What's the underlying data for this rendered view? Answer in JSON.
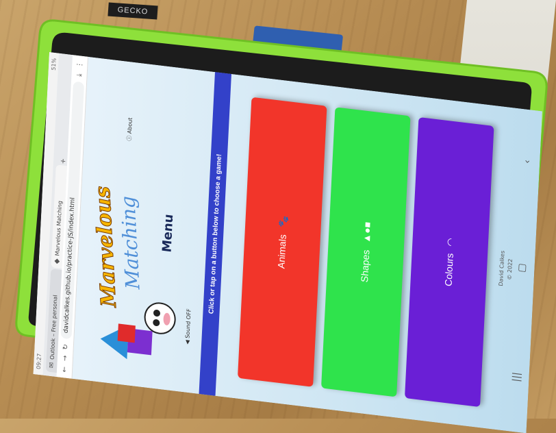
{
  "case_label": "GECKO",
  "browser": {
    "status_left": "09:27",
    "status_right": "51%",
    "tabs": [
      {
        "label": "Outlook – Free personal",
        "active": false
      },
      {
        "label": "Marvelous Matching",
        "active": true
      }
    ],
    "url": "davidcalkes.github.io/practice-JS/index.html"
  },
  "app": {
    "title_line1": "Marvelous",
    "title_line2": "Matching",
    "menu_heading": "Menu",
    "sound_toggle": "Sound OFF",
    "about_link": "About",
    "instruction": "Click   or tap   on a button below to choose a game!",
    "buttons": [
      {
        "label": "Animals",
        "icon": "paw-icon",
        "color": "#f2352a"
      },
      {
        "label": "Shapes",
        "icon": "shapes-icon",
        "color": "#2fe34c"
      },
      {
        "label": "Colours",
        "icon": "rainbow-icon",
        "color": "#6a1fd6"
      }
    ],
    "footer_author": "David Calkes",
    "footer_copyright": "© 2022"
  },
  "colors": {
    "case": "#8ee03b",
    "banner": "#3341c9"
  }
}
